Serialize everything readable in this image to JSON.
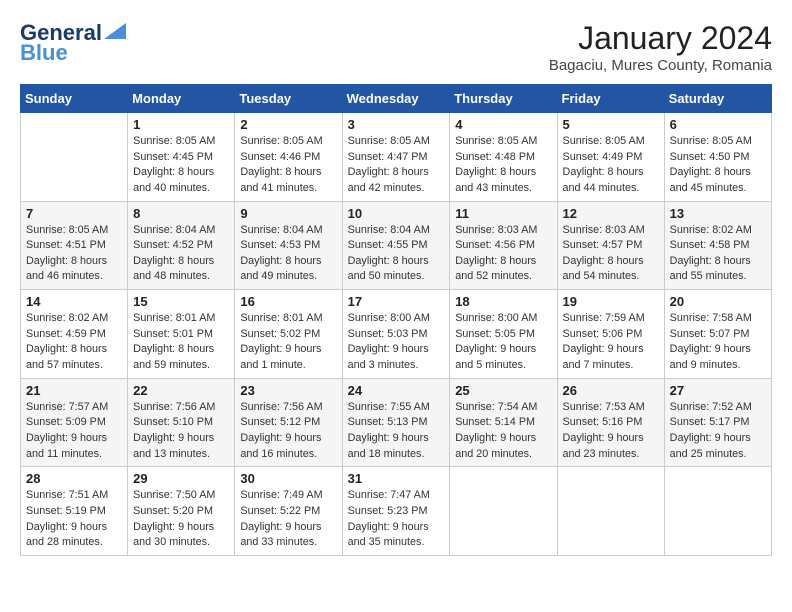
{
  "header": {
    "logo_line1": "General",
    "logo_line2": "Blue",
    "title": "January 2024",
    "subtitle": "Bagaciu, Mures County, Romania"
  },
  "days_of_week": [
    "Sunday",
    "Monday",
    "Tuesday",
    "Wednesday",
    "Thursday",
    "Friday",
    "Saturday"
  ],
  "weeks": [
    [
      {
        "day": "",
        "info": ""
      },
      {
        "day": "1",
        "info": "Sunrise: 8:05 AM\nSunset: 4:45 PM\nDaylight: 8 hours\nand 40 minutes."
      },
      {
        "day": "2",
        "info": "Sunrise: 8:05 AM\nSunset: 4:46 PM\nDaylight: 8 hours\nand 41 minutes."
      },
      {
        "day": "3",
        "info": "Sunrise: 8:05 AM\nSunset: 4:47 PM\nDaylight: 8 hours\nand 42 minutes."
      },
      {
        "day": "4",
        "info": "Sunrise: 8:05 AM\nSunset: 4:48 PM\nDaylight: 8 hours\nand 43 minutes."
      },
      {
        "day": "5",
        "info": "Sunrise: 8:05 AM\nSunset: 4:49 PM\nDaylight: 8 hours\nand 44 minutes."
      },
      {
        "day": "6",
        "info": "Sunrise: 8:05 AM\nSunset: 4:50 PM\nDaylight: 8 hours\nand 45 minutes."
      }
    ],
    [
      {
        "day": "7",
        "info": "Sunrise: 8:05 AM\nSunset: 4:51 PM\nDaylight: 8 hours\nand 46 minutes."
      },
      {
        "day": "8",
        "info": "Sunrise: 8:04 AM\nSunset: 4:52 PM\nDaylight: 8 hours\nand 48 minutes."
      },
      {
        "day": "9",
        "info": "Sunrise: 8:04 AM\nSunset: 4:53 PM\nDaylight: 8 hours\nand 49 minutes."
      },
      {
        "day": "10",
        "info": "Sunrise: 8:04 AM\nSunset: 4:55 PM\nDaylight: 8 hours\nand 50 minutes."
      },
      {
        "day": "11",
        "info": "Sunrise: 8:03 AM\nSunset: 4:56 PM\nDaylight: 8 hours\nand 52 minutes."
      },
      {
        "day": "12",
        "info": "Sunrise: 8:03 AM\nSunset: 4:57 PM\nDaylight: 8 hours\nand 54 minutes."
      },
      {
        "day": "13",
        "info": "Sunrise: 8:02 AM\nSunset: 4:58 PM\nDaylight: 8 hours\nand 55 minutes."
      }
    ],
    [
      {
        "day": "14",
        "info": "Sunrise: 8:02 AM\nSunset: 4:59 PM\nDaylight: 8 hours\nand 57 minutes."
      },
      {
        "day": "15",
        "info": "Sunrise: 8:01 AM\nSunset: 5:01 PM\nDaylight: 8 hours\nand 59 minutes."
      },
      {
        "day": "16",
        "info": "Sunrise: 8:01 AM\nSunset: 5:02 PM\nDaylight: 9 hours\nand 1 minute."
      },
      {
        "day": "17",
        "info": "Sunrise: 8:00 AM\nSunset: 5:03 PM\nDaylight: 9 hours\nand 3 minutes."
      },
      {
        "day": "18",
        "info": "Sunrise: 8:00 AM\nSunset: 5:05 PM\nDaylight: 9 hours\nand 5 minutes."
      },
      {
        "day": "19",
        "info": "Sunrise: 7:59 AM\nSunset: 5:06 PM\nDaylight: 9 hours\nand 7 minutes."
      },
      {
        "day": "20",
        "info": "Sunrise: 7:58 AM\nSunset: 5:07 PM\nDaylight: 9 hours\nand 9 minutes."
      }
    ],
    [
      {
        "day": "21",
        "info": "Sunrise: 7:57 AM\nSunset: 5:09 PM\nDaylight: 9 hours\nand 11 minutes."
      },
      {
        "day": "22",
        "info": "Sunrise: 7:56 AM\nSunset: 5:10 PM\nDaylight: 9 hours\nand 13 minutes."
      },
      {
        "day": "23",
        "info": "Sunrise: 7:56 AM\nSunset: 5:12 PM\nDaylight: 9 hours\nand 16 minutes."
      },
      {
        "day": "24",
        "info": "Sunrise: 7:55 AM\nSunset: 5:13 PM\nDaylight: 9 hours\nand 18 minutes."
      },
      {
        "day": "25",
        "info": "Sunrise: 7:54 AM\nSunset: 5:14 PM\nDaylight: 9 hours\nand 20 minutes."
      },
      {
        "day": "26",
        "info": "Sunrise: 7:53 AM\nSunset: 5:16 PM\nDaylight: 9 hours\nand 23 minutes."
      },
      {
        "day": "27",
        "info": "Sunrise: 7:52 AM\nSunset: 5:17 PM\nDaylight: 9 hours\nand 25 minutes."
      }
    ],
    [
      {
        "day": "28",
        "info": "Sunrise: 7:51 AM\nSunset: 5:19 PM\nDaylight: 9 hours\nand 28 minutes."
      },
      {
        "day": "29",
        "info": "Sunrise: 7:50 AM\nSunset: 5:20 PM\nDaylight: 9 hours\nand 30 minutes."
      },
      {
        "day": "30",
        "info": "Sunrise: 7:49 AM\nSunset: 5:22 PM\nDaylight: 9 hours\nand 33 minutes."
      },
      {
        "day": "31",
        "info": "Sunrise: 7:47 AM\nSunset: 5:23 PM\nDaylight: 9 hours\nand 35 minutes."
      },
      {
        "day": "",
        "info": ""
      },
      {
        "day": "",
        "info": ""
      },
      {
        "day": "",
        "info": ""
      }
    ]
  ]
}
